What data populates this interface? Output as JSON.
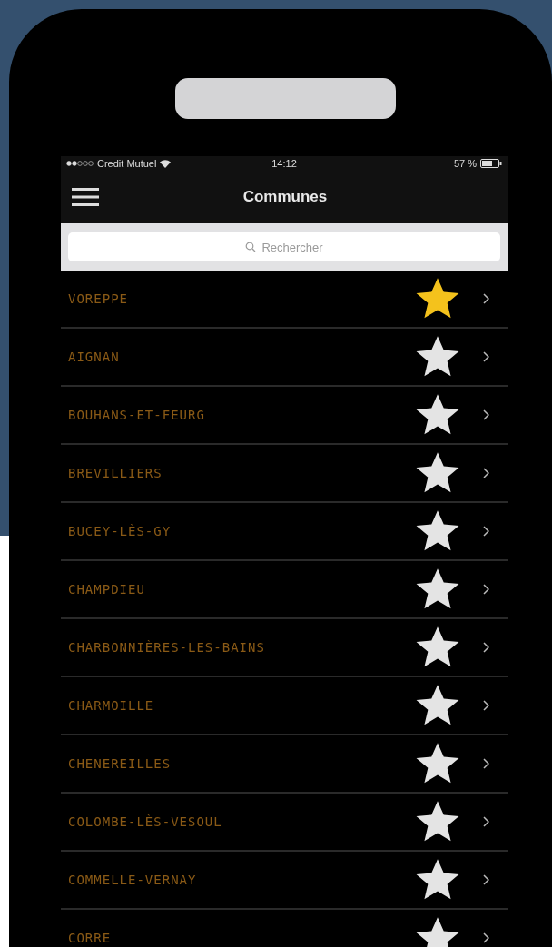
{
  "status_bar": {
    "carrier": "Credit Mutuel",
    "time": "14:12",
    "battery": "57 %"
  },
  "nav_bar": {
    "title": "Communes"
  },
  "search": {
    "placeholder": "Rechercher"
  },
  "communes": [
    {
      "name": "VOREPPE",
      "favorite": true
    },
    {
      "name": "AIGNAN",
      "favorite": false
    },
    {
      "name": "BOUHANS-ET-FEURG",
      "favorite": false
    },
    {
      "name": "BREVILLIERS",
      "favorite": false
    },
    {
      "name": "BUCEY-LÈS-GY",
      "favorite": false
    },
    {
      "name": "CHAMPDIEU",
      "favorite": false
    },
    {
      "name": "CHARBONNIÈRES-LES-BAINS",
      "favorite": false
    },
    {
      "name": "CHARMOILLE",
      "favorite": false
    },
    {
      "name": "CHENEREILLES",
      "favorite": false
    },
    {
      "name": "COLOMBE-LÈS-VESOUL",
      "favorite": false
    },
    {
      "name": "COMMELLE-VERNAY",
      "favorite": false
    },
    {
      "name": "CORRE",
      "favorite": false
    }
  ]
}
